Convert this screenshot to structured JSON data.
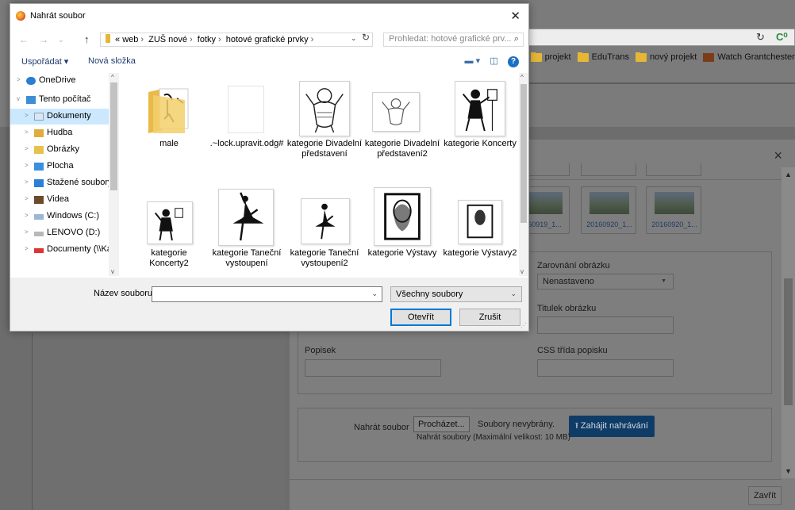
{
  "browser": {
    "bookmarks": [
      {
        "label": "k",
        "icon": "folder-icon"
      },
      {
        "label": "projekt",
        "icon": "folder-icon"
      },
      {
        "label": "EduTrans",
        "icon": "folder-icon"
      },
      {
        "label": "nový projekt",
        "icon": "folder-icon"
      },
      {
        "label": "Watch Grantchester S",
        "icon": "bookmark-favicon"
      }
    ]
  },
  "dialog": {
    "title": "Nahrát soubor",
    "breadcrumb": {
      "overflow": "«",
      "parts": [
        "web",
        "ZUŠ nové",
        "fotky",
        "hotové grafické prvky"
      ]
    },
    "search_placeholder": "Prohledat: hotové grafické prv...",
    "commands": {
      "organize": "Uspořádat ▾",
      "new_folder": "Nová složka"
    },
    "nav": [
      {
        "label": "OneDrive",
        "icon": "onedrive-icon",
        "level": 0,
        "toggle": ">"
      },
      {
        "label": "Tento počítač",
        "icon": "computer-icon",
        "level": 0,
        "toggle": "v"
      },
      {
        "label": "Dokumenty",
        "icon": "documents-icon",
        "level": 1,
        "toggle": ">",
        "selected": true
      },
      {
        "label": "Hudba",
        "icon": "music-icon",
        "level": 1,
        "toggle": ">"
      },
      {
        "label": "Obrázky",
        "icon": "pictures-icon",
        "level": 1,
        "toggle": ">"
      },
      {
        "label": "Plocha",
        "icon": "desktop-icon",
        "level": 1,
        "toggle": ">"
      },
      {
        "label": "Stažené soubory",
        "icon": "downloads-icon",
        "level": 1,
        "toggle": ">"
      },
      {
        "label": "Videa",
        "icon": "videos-icon",
        "level": 1,
        "toggle": ">"
      },
      {
        "label": "Windows (C:)",
        "icon": "drive-icon",
        "level": 1,
        "toggle": ">"
      },
      {
        "label": "LENOVO (D:)",
        "icon": "drive-icon",
        "level": 1,
        "toggle": ">"
      },
      {
        "label": "Documenty (\\\\Ka",
        "icon": "network-drive-icon",
        "level": 1,
        "toggle": ">"
      }
    ],
    "files": [
      {
        "name": "male",
        "kind": "folder"
      },
      {
        "name": ".~lock.upravit.odg#",
        "kind": "blank-file"
      },
      {
        "name": "kategorie Divadelní představení",
        "kind": "drawing"
      },
      {
        "name": "kategorie Divadelní představení2",
        "kind": "drawing"
      },
      {
        "name": "kategorie Koncerty",
        "kind": "drawing"
      },
      {
        "name": "kategorie Koncerty2",
        "kind": "drawing"
      },
      {
        "name": "kategorie Taneční vystoupení",
        "kind": "drawing"
      },
      {
        "name": "kategorie Taneční vystoupení2",
        "kind": "drawing"
      },
      {
        "name": "kategorie Výstavy",
        "kind": "drawing"
      },
      {
        "name": "kategorie Výstavy2",
        "kind": "drawing"
      }
    ],
    "filename_label": "Název souboru:",
    "filename_value": "",
    "filetype": "Všechny soubory",
    "open_label": "Otevřít",
    "cancel_label": "Zrušit"
  },
  "modal": {
    "thumbnails": [
      "160919_1...",
      "20160920_1...",
      "20160920_1..."
    ],
    "align_label": "Zarovnání obrázku",
    "align_value": "Nenastaveno",
    "caption_title_label": "Titulek obrázku",
    "caption_label": "Popisek",
    "caption_css_label": "CSS třída popisku",
    "upload_label": "Nahrát soubor",
    "browse_label": "Procházet...",
    "no_files_label": "Soubory nevybrány.",
    "upload_start_label": "Zahájit nahrávání",
    "upload_hint": "Nahrát soubory (Maximální velikost: 10 MB)",
    "close_label": "Zavřít",
    "close_x": "×"
  }
}
